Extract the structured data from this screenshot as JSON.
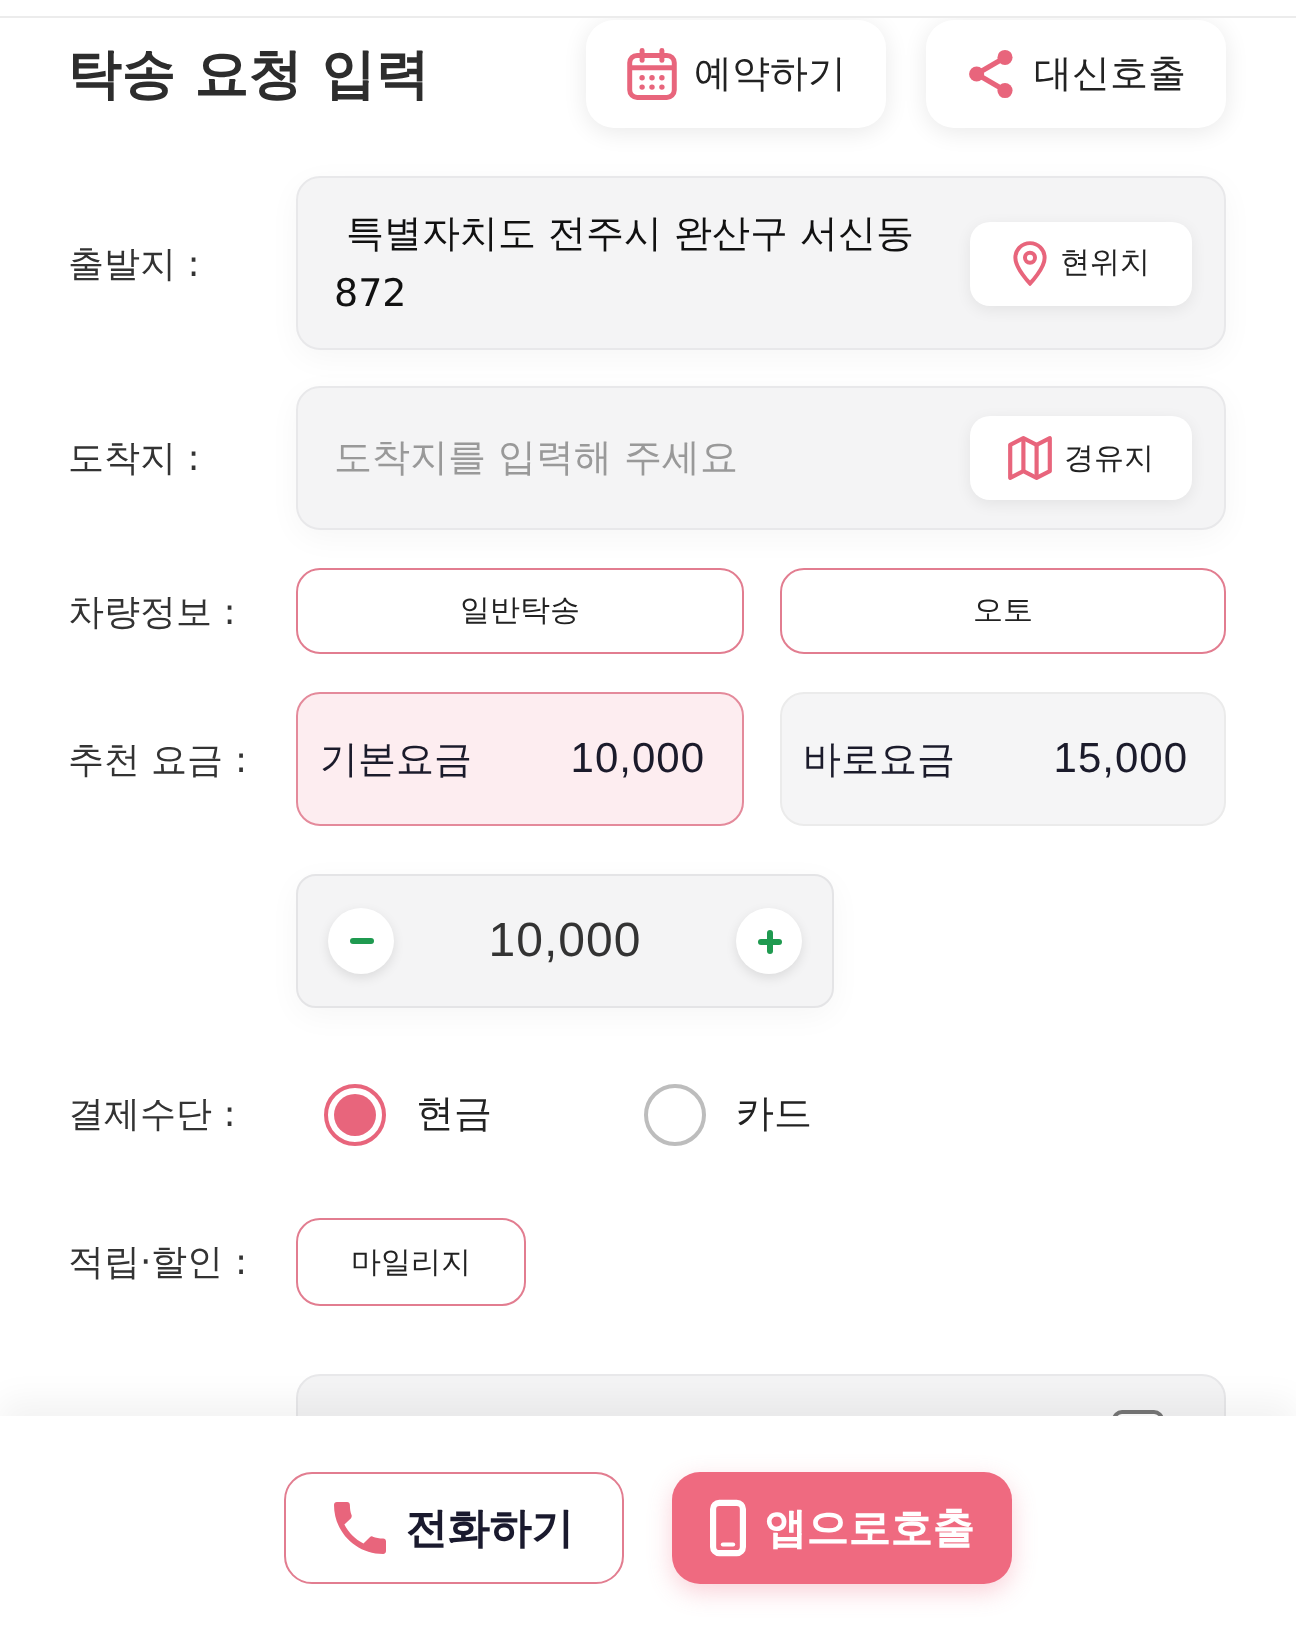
{
  "header": {
    "title": "탁송 요청 입력",
    "actions": [
      {
        "label": "예약하기",
        "kind": "calendar"
      },
      {
        "label": "대신호출",
        "kind": "share"
      }
    ]
  },
  "form": {
    "departure": {
      "label": "출발지 :",
      "value": " 특별자치도 전주시 완산구 서신동 872",
      "button": "현위치"
    },
    "destination": {
      "label": "도착지 :",
      "placeholder": "도착지를 입력해 주세요",
      "button": "경유지"
    },
    "vehicle": {
      "label": "차량정보 :",
      "options": [
        "일반탁송",
        "오토"
      ]
    },
    "fare": {
      "label": "추천 요금 :",
      "options": [
        {
          "name": "기본요금",
          "amount": "10,000",
          "selected": true
        },
        {
          "name": "바로요금",
          "amount": "15,000",
          "selected": false
        }
      ],
      "stepper": {
        "value": "10,000"
      }
    },
    "payment": {
      "label": "결제수단 :",
      "options": [
        {
          "label": "현금",
          "selected": true
        },
        {
          "label": "카드",
          "selected": false
        }
      ]
    },
    "discount": {
      "label": "적립·할인 :",
      "options": [
        "마일리지"
      ]
    }
  },
  "bottom_bar": {
    "buttons": [
      {
        "label": "전화하기",
        "kind": "phone"
      },
      {
        "label": "앱으로호출",
        "kind": "app"
      }
    ]
  }
}
